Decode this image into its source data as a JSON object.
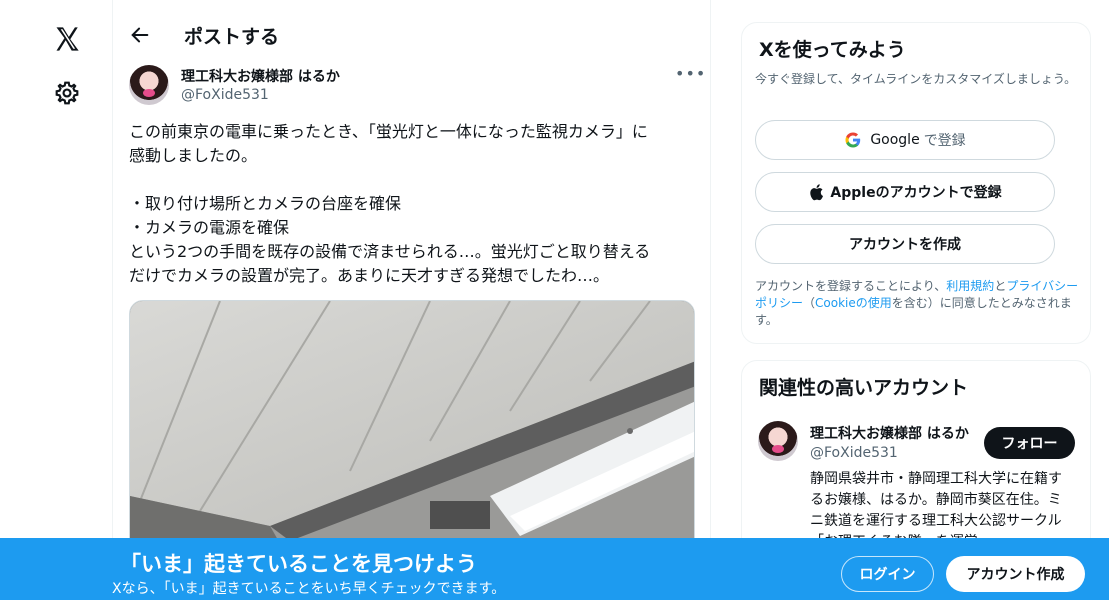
{
  "nav": {
    "logo_icon": "x-logo-icon",
    "settings_icon": "gear-icon"
  },
  "header": {
    "title": "ポストする"
  },
  "post": {
    "author_name": "理工科大お嬢様部 はるか",
    "author_handle": "@FoXide531",
    "text_lines": [
      "この前東京の電車に乗ったとき、「蛍光灯と一体になった監視カメラ」に",
      "感動しましたの。",
      "",
      "・取り付け場所とカメラの台座を確保",
      "・カメラの電源を確保",
      "という2つの手間を既存の設備で済ませられる…。蛍光灯ごと取り替える",
      "だけでカメラの設置が完了。あまりに天才すぎる発想でしたわ…。"
    ]
  },
  "signup_card": {
    "title": "Xを使ってみよう",
    "subtitle": "今すぐ登録して、タイムラインをカスタマイズしましょう。",
    "google_label": "Google",
    "google_suffix": "で登録",
    "apple_label": "Appleのアカウントで登録",
    "create_label": "アカウントを作成",
    "legal_prefix": "アカウントを登録することにより、",
    "terms_link": "利用規約",
    "legal_and": "と",
    "privacy_link": "プライバシーポリシー",
    "legal_paren_open": "（",
    "cookie_link": "Cookieの使用",
    "legal_suffix": "を含む）に同意したとみなされます。"
  },
  "related_card": {
    "title": "関連性の高いアカウント",
    "name": "理工科大お嬢様部 はるか",
    "handle": "@FoXide531",
    "follow_label": "フォロー",
    "bio": "静岡県袋井市・静岡理工科大学に在籍するお嬢様、はるか。静岡市葵区在住。ミニ鉄道を運行する理工科大公認サークル「お理工くるむ隊」を運営"
  },
  "banner": {
    "title": "「いま」起きていることを見つけよう",
    "subtitle": "Xなら、「いま」起きていることをいち早くチェックできます。",
    "login_label": "ログイン",
    "signup_label": "アカウント作成"
  },
  "colors": {
    "accent": "#1d9bf0",
    "text": "#0f1419",
    "muted": "#536471",
    "border": "#eff3f4"
  }
}
